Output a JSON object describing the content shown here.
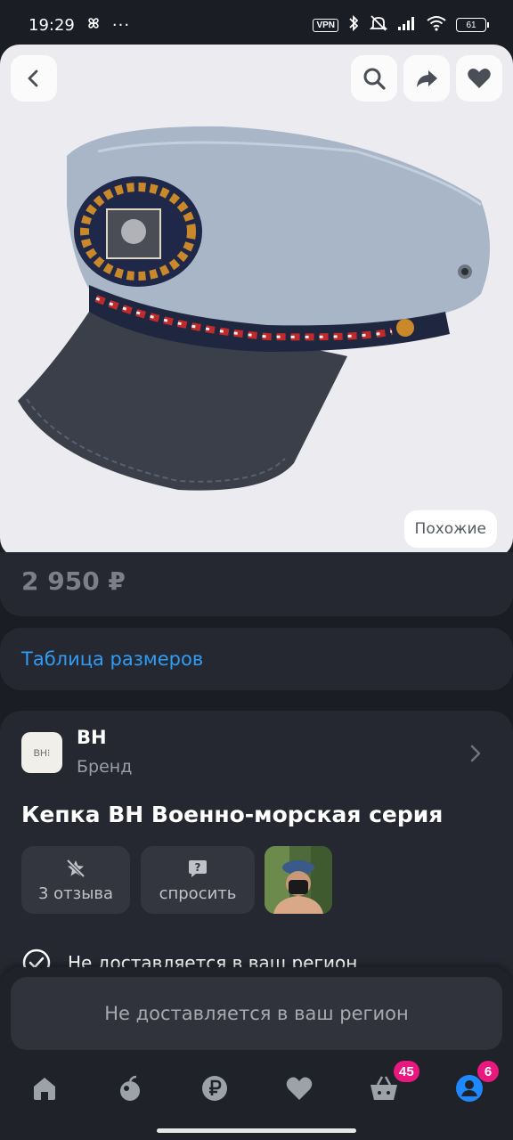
{
  "status_bar": {
    "time": "19:29",
    "vpn": "VPN",
    "battery": "61"
  },
  "product": {
    "price": "2 950 ₽",
    "similar_label": "Похожие",
    "size_table_label": "Таблица размеров",
    "brand_logo_text": "BH⁝",
    "brand_name": "BH",
    "brand_subtitle": "Бренд",
    "title": "Кепка BH Военно-морская серия",
    "reviews_label": "3 отзыва",
    "ask_label": "спросить",
    "delivery_notice": "Не доставляется в ваш регион"
  },
  "bottom": {
    "button_label": "Не доставляется в ваш регион"
  },
  "nav": {
    "cart_badge": "45",
    "profile_badge": "6"
  },
  "colors": {
    "background": "#1a1d24",
    "card": "#252830",
    "link": "#2f9cf5",
    "badge": "#e8187f",
    "profile": "#1e88ff"
  }
}
